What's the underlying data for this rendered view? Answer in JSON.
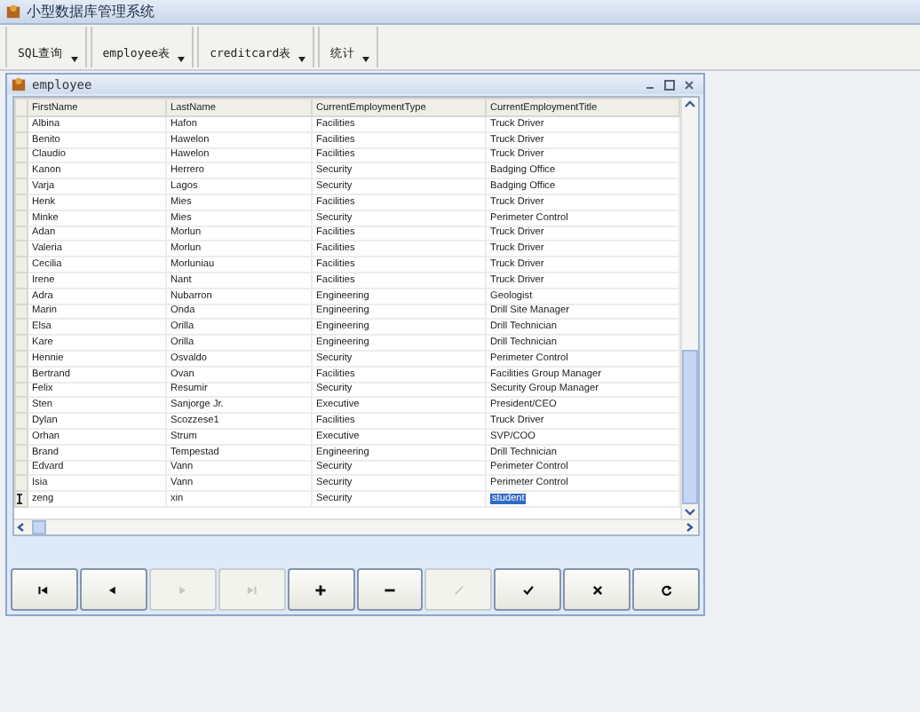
{
  "window": {
    "title": "小型数据库管理系统"
  },
  "toolbar": [
    {
      "label": "SQL查询"
    },
    {
      "label": "employee表"
    },
    {
      "label": "creditcard表"
    },
    {
      "label": "统计"
    }
  ],
  "child_window": {
    "title": "employee"
  },
  "table": {
    "columns": [
      "FirstName",
      "LastName",
      "CurrentEmploymentType",
      "CurrentEmploymentTitle"
    ],
    "rows": [
      {
        "cells": [
          "Albina",
          "Hafon",
          "Facilities",
          "Truck Driver"
        ],
        "current": false
      },
      {
        "cells": [
          "Benito",
          "Hawelon",
          "Facilities",
          "Truck Driver"
        ],
        "current": false
      },
      {
        "cells": [
          "Claudio",
          "Hawelon",
          "Facilities",
          "Truck Driver"
        ],
        "current": false
      },
      {
        "cells": [
          "Kanon",
          "Herrero",
          "Security",
          "Badging Office"
        ],
        "current": false
      },
      {
        "cells": [
          "Varja",
          "Lagos",
          "Security",
          "Badging Office"
        ],
        "current": false
      },
      {
        "cells": [
          "Henk",
          "Mies",
          "Facilities",
          "Truck Driver"
        ],
        "current": false
      },
      {
        "cells": [
          "Minke",
          "Mies",
          "Security",
          "Perimeter Control"
        ],
        "current": false
      },
      {
        "cells": [
          "Adan",
          "Morlun",
          "Facilities",
          "Truck Driver"
        ],
        "current": false
      },
      {
        "cells": [
          "Valeria",
          "Morlun",
          "Facilities",
          "Truck Driver"
        ],
        "current": false
      },
      {
        "cells": [
          "Cecilia",
          "Morluniau",
          "Facilities",
          "Truck Driver"
        ],
        "current": false
      },
      {
        "cells": [
          "Irene",
          "Nant",
          "Facilities",
          "Truck Driver"
        ],
        "current": false
      },
      {
        "cells": [
          "Adra",
          "Nubarron",
          "Engineering",
          "Geologist"
        ],
        "current": false
      },
      {
        "cells": [
          "Marin",
          "Onda",
          "Engineering",
          "Drill Site Manager"
        ],
        "current": false
      },
      {
        "cells": [
          "Elsa",
          "Orilla",
          "Engineering",
          "Drill Technician"
        ],
        "current": false
      },
      {
        "cells": [
          "Kare",
          "Orilla",
          "Engineering",
          "Drill Technician"
        ],
        "current": false
      },
      {
        "cells": [
          "Hennie",
          "Osvaldo",
          "Security",
          "Perimeter Control"
        ],
        "current": false
      },
      {
        "cells": [
          "Bertrand",
          "Ovan",
          "Facilities",
          "Facilities Group Manager"
        ],
        "current": false
      },
      {
        "cells": [
          "Felix",
          "Resumir",
          "Security",
          "Security Group Manager"
        ],
        "current": false
      },
      {
        "cells": [
          "Sten",
          "Sanjorge Jr.",
          "Executive",
          "President/CEO"
        ],
        "current": false
      },
      {
        "cells": [
          "Dylan",
          "Scozzese1",
          "Facilities",
          "Truck Driver"
        ],
        "current": false
      },
      {
        "cells": [
          "Orhan",
          "Strum",
          "Executive",
          "SVP/COO"
        ],
        "current": false
      },
      {
        "cells": [
          "Brand",
          "Tempestad",
          "Engineering",
          "Drill Technician"
        ],
        "current": false
      },
      {
        "cells": [
          "Edvard",
          "Vann",
          "Security",
          "Perimeter Control"
        ],
        "current": false
      },
      {
        "cells": [
          "Isia",
          "Vann",
          "Security",
          "Perimeter Control"
        ],
        "current": false
      },
      {
        "cells": [
          "zeng",
          "xin",
          "Security",
          "student"
        ],
        "current": true
      }
    ]
  },
  "navigator": [
    {
      "kind": "first",
      "disabled": false
    },
    {
      "kind": "prior",
      "disabled": false
    },
    {
      "kind": "next",
      "disabled": true
    },
    {
      "kind": "last",
      "disabled": true
    },
    {
      "kind": "insert",
      "disabled": false
    },
    {
      "kind": "delete",
      "disabled": false
    },
    {
      "kind": "edit",
      "disabled": true
    },
    {
      "kind": "post",
      "disabled": false
    },
    {
      "kind": "cancel",
      "disabled": false
    },
    {
      "kind": "refresh",
      "disabled": false
    }
  ]
}
